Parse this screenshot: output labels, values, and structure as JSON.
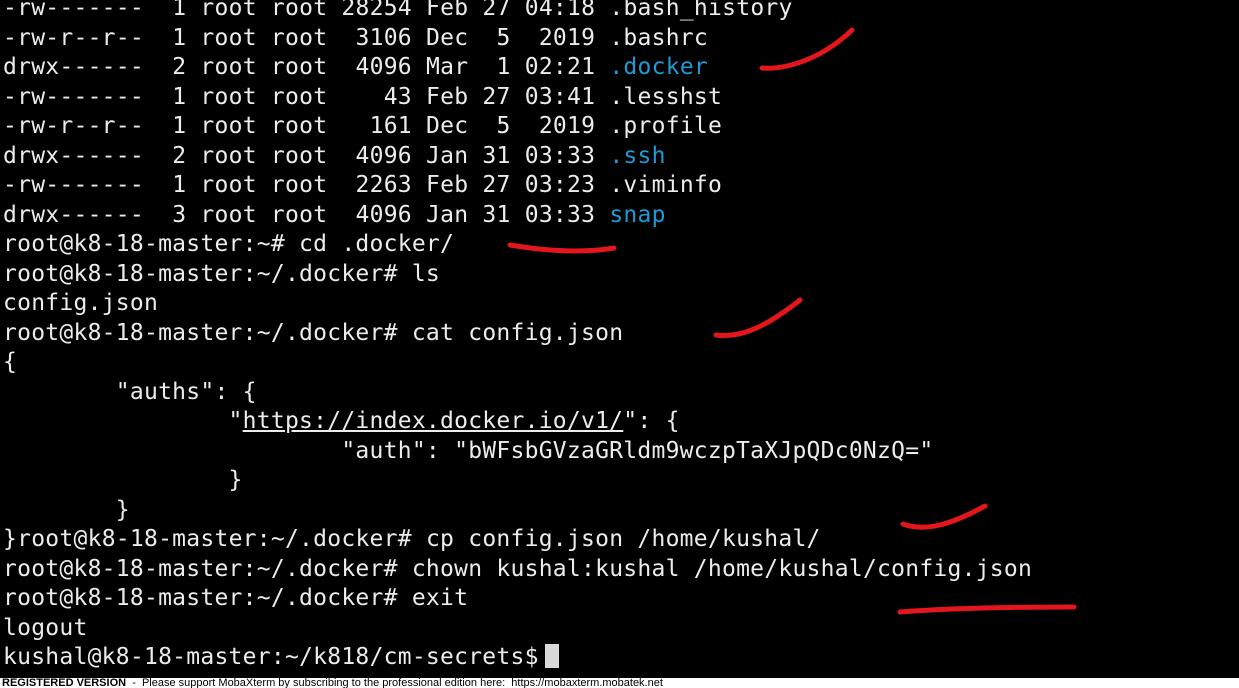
{
  "terminal": {
    "listing": [
      {
        "perm": "-rw-------",
        "links": "1",
        "owner": "root",
        "group": "root",
        "size": "28254",
        "month": "Feb",
        "day": "27",
        "time": "04:18",
        "name": ".bash_history",
        "dir": false
      },
      {
        "perm": "-rw-r--r--",
        "links": "1",
        "owner": "root",
        "group": "root",
        "size": "3106",
        "month": "Dec",
        "day": "5",
        "time": "2019",
        "name": ".bashrc",
        "dir": false
      },
      {
        "perm": "drwx------",
        "links": "2",
        "owner": "root",
        "group": "root",
        "size": "4096",
        "month": "Mar",
        "day": "1",
        "time": "02:21",
        "name": ".docker",
        "dir": true
      },
      {
        "perm": "-rw-------",
        "links": "1",
        "owner": "root",
        "group": "root",
        "size": "43",
        "month": "Feb",
        "day": "27",
        "time": "03:41",
        "name": ".lesshst",
        "dir": false
      },
      {
        "perm": "-rw-r--r--",
        "links": "1",
        "owner": "root",
        "group": "root",
        "size": "161",
        "month": "Dec",
        "day": "5",
        "time": "2019",
        "name": ".profile",
        "dir": false
      },
      {
        "perm": "drwx------",
        "links": "2",
        "owner": "root",
        "group": "root",
        "size": "4096",
        "month": "Jan",
        "day": "31",
        "time": "03:33",
        "name": ".ssh",
        "dir": true
      },
      {
        "perm": "-rw-------",
        "links": "1",
        "owner": "root",
        "group": "root",
        "size": "2263",
        "month": "Feb",
        "day": "27",
        "time": "03:23",
        "name": ".viminfo",
        "dir": false
      },
      {
        "perm": "drwx------",
        "links": "3",
        "owner": "root",
        "group": "root",
        "size": "4096",
        "month": "Jan",
        "day": "31",
        "time": "03:33",
        "name": "snap",
        "dir": true
      }
    ],
    "session": [
      {
        "prompt": "root@k8-18-master:~# ",
        "command": "cd .docker/"
      },
      {
        "prompt": "root@k8-18-master:~/.docker# ",
        "command": "ls"
      },
      {
        "output": "config.json"
      },
      {
        "prompt": "root@k8-18-master:~/.docker# ",
        "command": "cat config.json"
      }
    ],
    "json_output": {
      "open_brace": "{",
      "auths_line": "        \"auths\": {",
      "url_indent": "                \"",
      "url": "https://index.docker.io/v1/",
      "url_suffix": "\": {",
      "auth_line": "                        \"auth\": \"bWFsbGVzaGRldm9wczpTaXJpQDc0NzQ=\"",
      "inner_close": "                }",
      "outer_close": "        }",
      "final_close": "}"
    },
    "session2": [
      {
        "prompt": "root@k8-18-master:~/.docker# ",
        "command": "cp config.json /home/kushal/"
      },
      {
        "prompt": "root@k8-18-master:~/.docker# ",
        "command": "chown kushal:kushal /home/kushal/config.json"
      },
      {
        "prompt": "root@k8-18-master:~/.docker# ",
        "command": "exit"
      },
      {
        "output": "logout"
      }
    ],
    "current_prompt": "kushal@k8-18-master:~/k818/cm-secrets$"
  },
  "status_bar": {
    "bold": "REGISTERED VERSION",
    "text": "  -  Please support MobaXterm by subscribing to the professional edition here:  https://mobaxterm.mobatek.net"
  },
  "colors": {
    "background": "#000000",
    "foreground": "#ececec",
    "directory": "#1e9ad6",
    "annotation": "#e3161b"
  }
}
